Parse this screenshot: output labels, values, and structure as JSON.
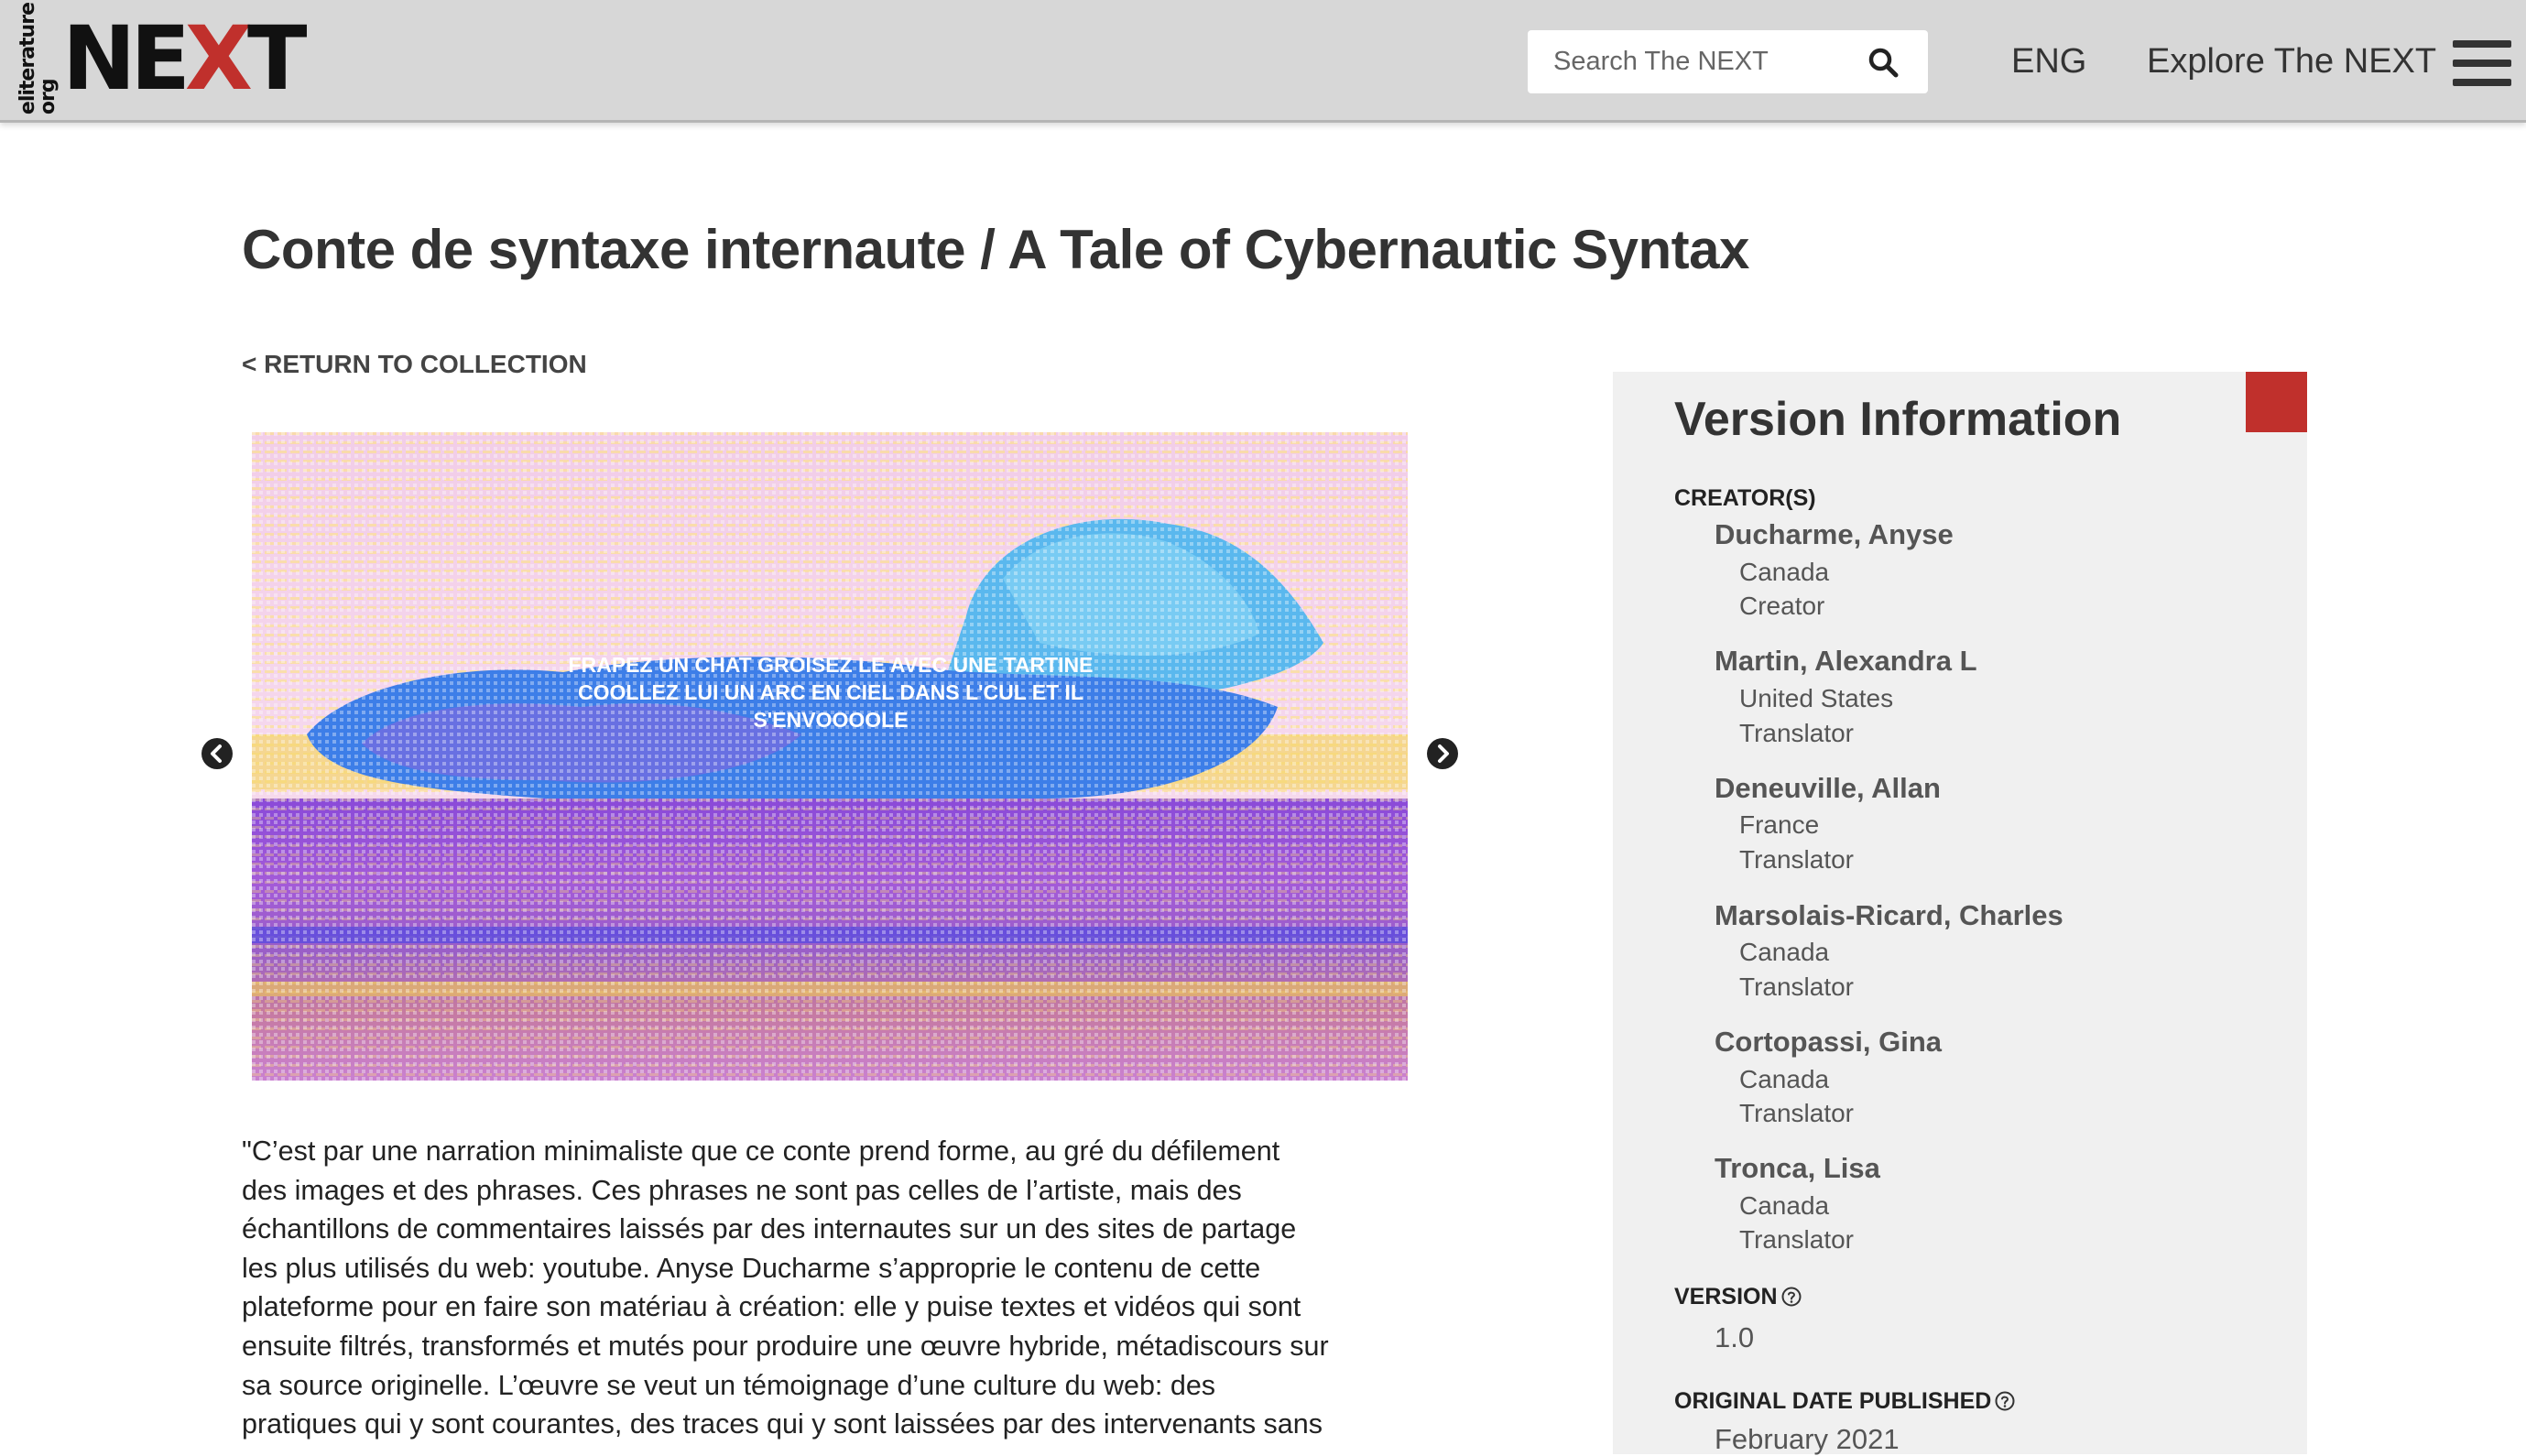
{
  "header": {
    "logo_small": "eliterature org",
    "logo_main_left": "NE",
    "logo_main_x": "X",
    "logo_main_right": "T",
    "search_placeholder": "Search The NEXT",
    "language": "ENG",
    "explore_label": "Explore The NEXT"
  },
  "main": {
    "title": "Conte de syntaxe internaute / A Tale of Cybernautic Syntax",
    "return_link": "< RETURN TO COLLECTION",
    "carousel_caption_lines": [
      "FRAPEZ UN CHAT GROISEZ LE AVEC UNE TARTINE",
      "COOLLEZ LUI UN ARC EN CIEL DANS L'CUL ET IL",
      "S'ENVOOOOLE"
    ],
    "description": "\"C’est par une narration minimaliste que ce conte prend forme, au gré du défilement des images et des phrases. Ces phrases ne sont pas celles de l’artiste, mais des échantillons de commentaires laissés par des internautes sur un des sites de partage les plus utilisés du web: youtube. Anyse Ducharme s’approprie le contenu de cette plateforme pour en faire son matériau à création: elle y puise textes et vidéos qui sont ensuite filtrés, transformés et mutés pour produire une œuvre hybride, métadiscours sur sa source originelle. L’œuvre se veut un témoignage d’une culture du web: des pratiques qui y sont courantes, des traces qui y sont laissées par des intervenants sans"
  },
  "sidebar": {
    "title": "Version Information",
    "creators_label": "CREATOR(S)",
    "creators": [
      {
        "name": "Ducharme, Anyse",
        "country": "Canada",
        "role": "Creator"
      },
      {
        "name": "Martin, Alexandra L",
        "country": "United States",
        "role": "Translator"
      },
      {
        "name": "Deneuville, Allan",
        "country": "France",
        "role": "Translator"
      },
      {
        "name": "Marsolais-Ricard, Charles",
        "country": "Canada",
        "role": "Translator"
      },
      {
        "name": "Cortopassi, Gina",
        "country": "Canada",
        "role": "Translator"
      },
      {
        "name": "Tronca, Lisa",
        "country": "Canada",
        "role": "Translator"
      }
    ],
    "version_label": "VERSION",
    "version_value": "1.0",
    "date_label": "ORIGINAL DATE PUBLISHED",
    "date_value": "February 2021"
  },
  "colors": {
    "header_bg": "#d7d7d7",
    "accent_red": "#c0302c",
    "sidebar_bg": "#f0f0f0"
  },
  "icons": {
    "search": "search-icon",
    "menu": "hamburger-menu-icon",
    "prev": "arrow-left-icon",
    "next": "arrow-right-icon",
    "help": "help-circle-icon"
  }
}
